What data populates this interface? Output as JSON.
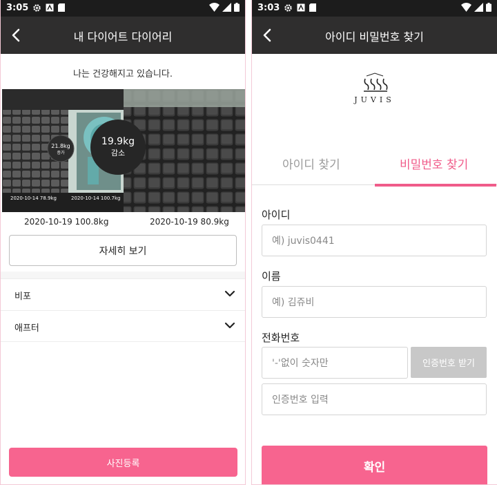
{
  "left": {
    "status": {
      "time": "3:05"
    },
    "appbar": {
      "title": "내 다이어트 다이어리"
    },
    "subtitle": "나는 건강해지고 있습니다.",
    "photo": {
      "small_badge": {
        "value": "21.8kg",
        "label": "증가"
      },
      "big_badge": {
        "value": "19.9kg",
        "label": "감소"
      },
      "inner_date_1": "2020-10-14 78.9kg",
      "inner_date_2": "2020-10-14 100.7kg"
    },
    "dates": {
      "before": "2020-10-19 100.8kg",
      "after": "2020-10-19 80.9kg"
    },
    "detail_button": "자세히 보기",
    "accordion": [
      {
        "label": "비포"
      },
      {
        "label": "애프터"
      }
    ],
    "register_button": "사진등록"
  },
  "right": {
    "status": {
      "time": "3:03"
    },
    "appbar": {
      "title": "아이디 비밀번호 찾기"
    },
    "logo_text": "JUVIS",
    "tabs": [
      {
        "label": "아이디 찾기",
        "active": false
      },
      {
        "label": "비밀번호 찾기",
        "active": true
      }
    ],
    "fields": {
      "id": {
        "label": "아이디",
        "placeholder": "예) juvis0441"
      },
      "name": {
        "label": "이름",
        "placeholder": "예) 김쥬비"
      },
      "phone": {
        "label": "전화번호",
        "placeholder": "'-'없이 숫자만",
        "verify_button": "인증번호 받기"
      },
      "code": {
        "placeholder": "인증번호 입력"
      }
    },
    "confirm_button": "확인"
  },
  "colors": {
    "accent": "#f7648f",
    "appbar": "#2f2e2e",
    "statusbar": "#1c1c1c",
    "disabled": "#c8c8c8"
  },
  "icons": {
    "status_left": [
      "gear-icon",
      "a-box-icon",
      "sd-card-icon"
    ],
    "status_right": [
      "wifi-icon",
      "signal-icon",
      "battery-icon"
    ],
    "back": "back-arrow-icon",
    "chevron": "chevron-down-icon"
  }
}
